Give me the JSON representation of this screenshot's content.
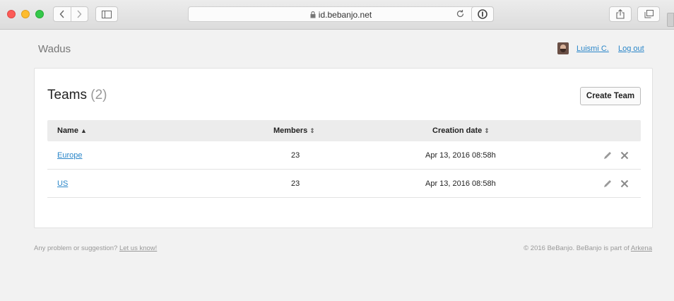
{
  "browser": {
    "url": "id.bebanjo.net"
  },
  "header": {
    "brand": "Wadus",
    "user_name": "Luismi C.",
    "logout_label": "Log out"
  },
  "teams": {
    "title": "Teams",
    "count": "(2)",
    "create_label": "Create Team",
    "columns": {
      "name": "Name",
      "name_sort": "▲",
      "members": "Members",
      "members_sort": "⇕",
      "date": "Creation date",
      "date_sort": "⇕"
    },
    "rows": [
      {
        "name": "Europe",
        "members": "23",
        "created": "Apr 13, 2016 08:58h"
      },
      {
        "name": "US",
        "members": "23",
        "created": "Apr 13, 2016 08:58h"
      }
    ]
  },
  "footer": {
    "prompt": "Any problem or suggestion?",
    "feedback_link": "Let us know!",
    "copyright": "© 2016 BeBanjo. BeBanjo is part of",
    "parent_link": "Arkena"
  },
  "colors": {
    "link": "#2a86c9",
    "muted": "#999999"
  }
}
